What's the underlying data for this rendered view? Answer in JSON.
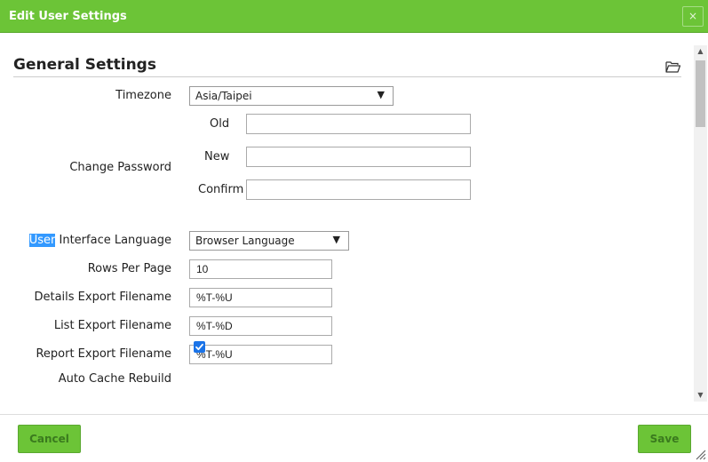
{
  "dialog": {
    "title": "Edit User Settings",
    "close_label": "×"
  },
  "section": {
    "title": "General Settings"
  },
  "fields": {
    "timezone": {
      "label": "Timezone",
      "value": "Asia/Taipei"
    },
    "password": {
      "label": "Change Password",
      "old_label": "Old",
      "old_value": "",
      "new_label": "New",
      "new_value": "",
      "confirm_label": "Confirm",
      "confirm_value": ""
    },
    "ui_language": {
      "label_highlighted": "User",
      "label_rest": " Interface Language",
      "value": "Browser Language"
    },
    "rows_per_page": {
      "label": "Rows Per Page",
      "value": "10"
    },
    "details_export": {
      "label": "Details Export Filename",
      "value": "%T-%U"
    },
    "list_export": {
      "label": "List Export Filename",
      "value": "%T-%D"
    },
    "report_export": {
      "label": "Report Export Filename",
      "value": "%T-%U"
    },
    "auto_cache": {
      "label": "Auto Cache Rebuild",
      "checked": true
    }
  },
  "buttons": {
    "cancel_label": "Cancel",
    "save_label": "Save"
  },
  "icons": {
    "folder": "folder-open-icon",
    "dropdown": "caret-down-icon",
    "check": "checkmark-icon"
  },
  "colors": {
    "accent": "#6cc437",
    "checkbox": "#1a73e8",
    "highlight": "#3399ff"
  }
}
